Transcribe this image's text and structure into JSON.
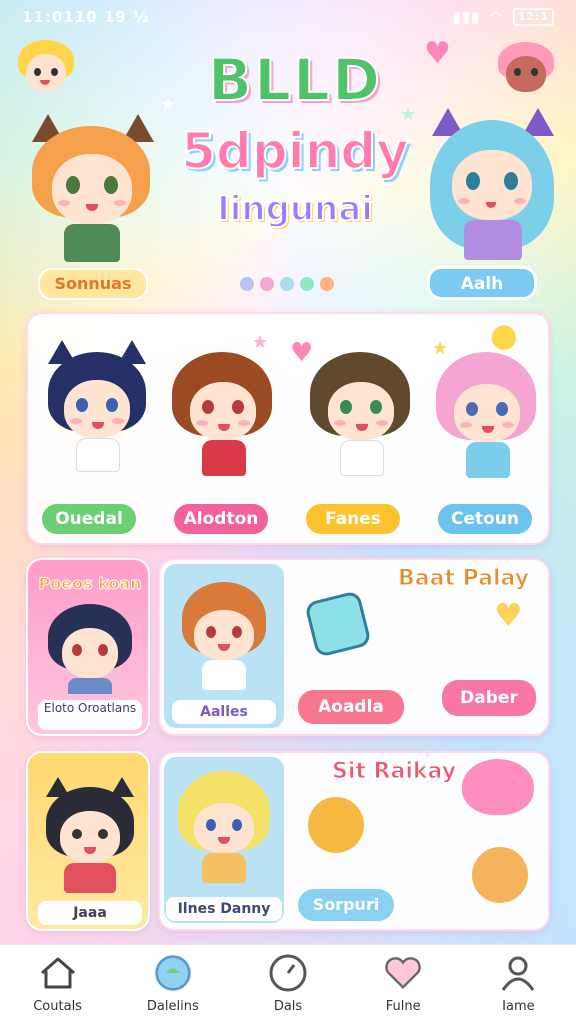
{
  "status_bar": {
    "time": "11:0110 19 ½",
    "battery": "12:1"
  },
  "header": {
    "logo_line1": "BLLD",
    "logo_line2": "5dpindy",
    "logo_line3": "Iingunai",
    "left_pill": "Sonnuas",
    "right_pill": "Aalh",
    "carousel_dots": [
      "#b7c2f5",
      "#f6a9d0",
      "#a9dcf2",
      "#8ee8c2",
      "#ffb27a"
    ]
  },
  "featured": {
    "characters": [
      {
        "name": "Ouedal",
        "color": "#6bcf73",
        "hair": "#253066",
        "shirt": "#ffffff"
      },
      {
        "name": "Alodton",
        "color": "#f3609a",
        "hair": "#9b4a24",
        "shirt": "#d93a48"
      },
      {
        "name": "Fanes",
        "color": "#fcc42c",
        "hair": "#5f4a2e",
        "shirt": "#ffffff"
      },
      {
        "name": "Cetoun",
        "color": "#6cc3ee",
        "hair": "#f6a4d2",
        "shirt": "#7ccdec"
      }
    ]
  },
  "row2": {
    "tile_label_top": "Poeos koan",
    "tile_label_bottom": "Eloto Oroatlans",
    "second_tile_label": "Aalles",
    "headline": "Baat Palay",
    "button_primary": "Aoadla",
    "button_secondary": "Daber"
  },
  "row3": {
    "tile_label": "Jaaa",
    "second_tile_label": "Ilnes Danny",
    "headline": "Sit Raikay",
    "button": "Sorpuri"
  },
  "nav": [
    {
      "label": "Coutals",
      "icon": "home-icon"
    },
    {
      "label": "Dalelins",
      "icon": "chat-bubble-icon"
    },
    {
      "label": "Dals",
      "icon": "globe-icon"
    },
    {
      "label": "Fulne",
      "icon": "heart-icon"
    },
    {
      "label": "Iame",
      "icon": "profile-icon"
    }
  ]
}
